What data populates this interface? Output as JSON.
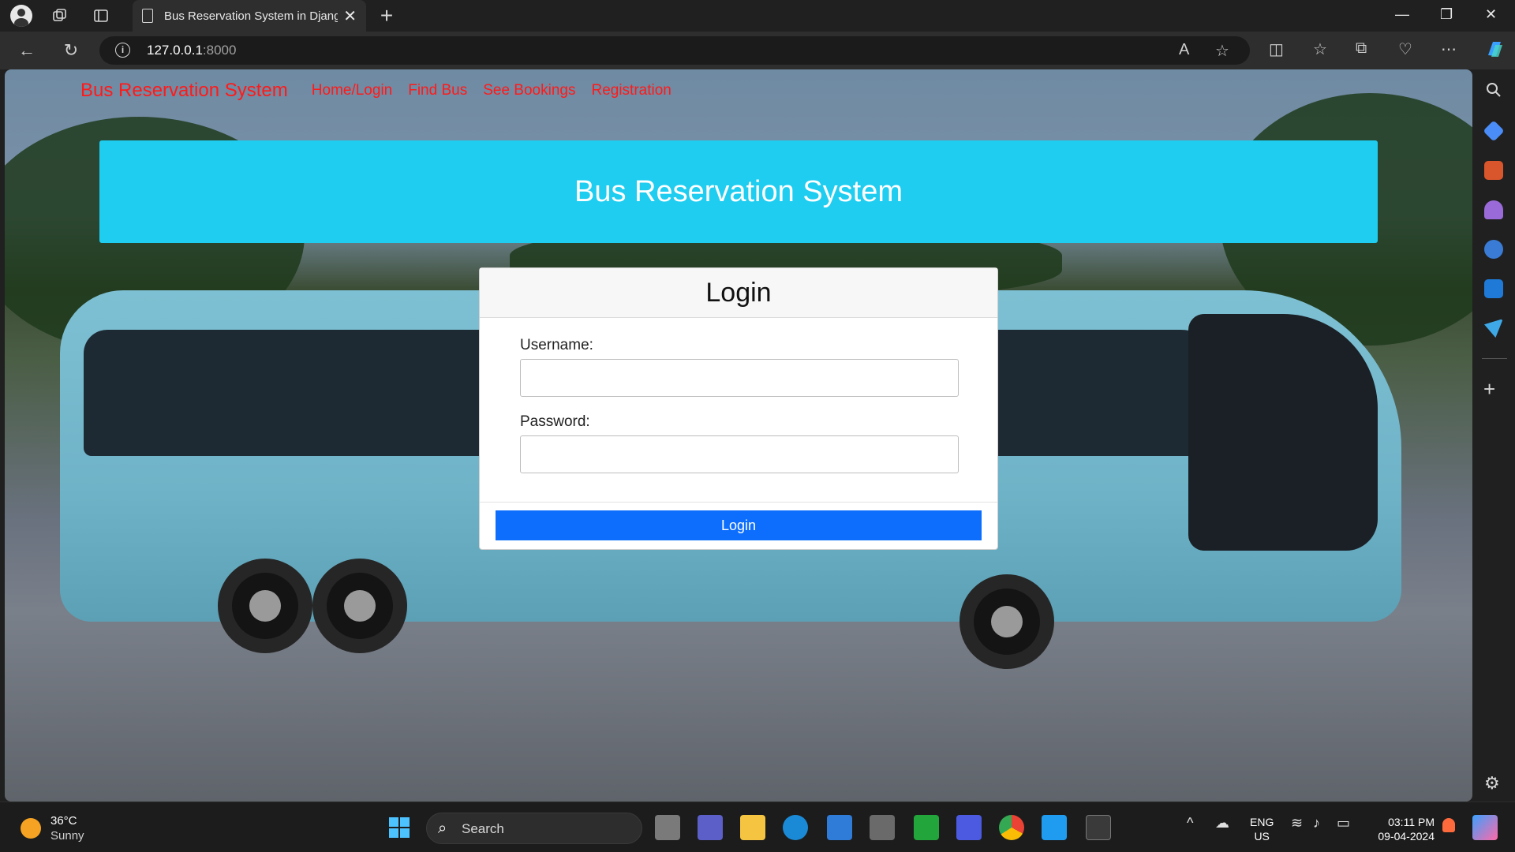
{
  "browser": {
    "tab_title": "Bus Reservation System in Djang",
    "url_host": "127.0.0.1",
    "url_port": ":8000"
  },
  "page": {
    "brand": "Bus Reservation System",
    "nav": [
      "Home/Login",
      "Find Bus",
      "See Bookings",
      "Registration"
    ],
    "banner_title": "Bus Reservation System",
    "login_card": {
      "title": "Login",
      "username_label": "Username:",
      "password_label": "Password:",
      "username_value": "",
      "password_value": "",
      "submit_label": "Login"
    }
  },
  "taskbar": {
    "weather_temp": "36°C",
    "weather_desc": "Sunny",
    "search_label": "Search",
    "lang_primary": "ENG",
    "lang_secondary": "US",
    "time": "03:11 PM",
    "date": "09-04-2024"
  },
  "colors": {
    "brand_link": "#ff1a1a",
    "banner": "#1fcdf0",
    "button": "#0d6efd"
  }
}
